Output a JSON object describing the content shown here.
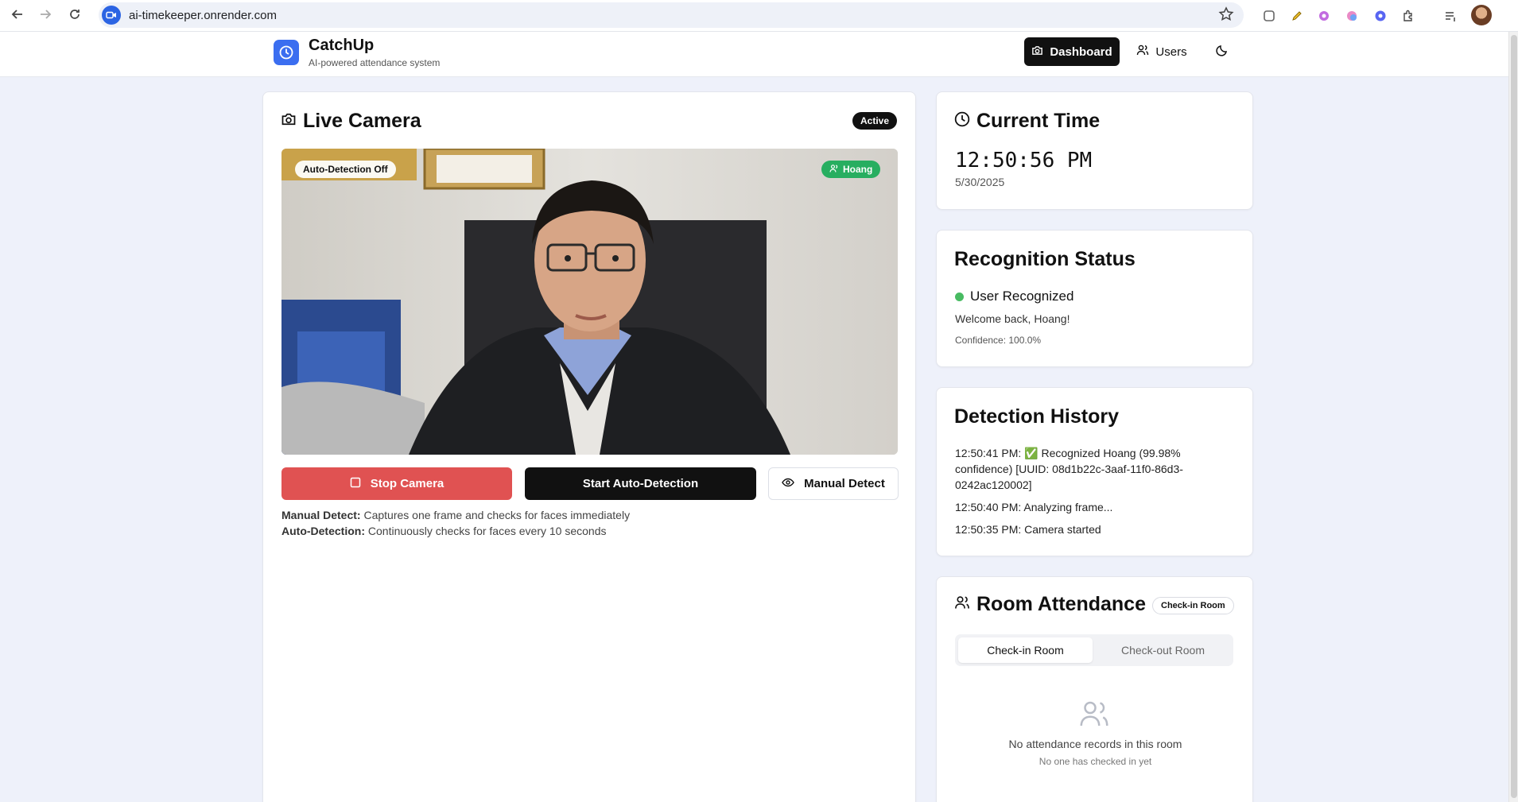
{
  "browser": {
    "url": "ai-timekeeper.onrender.com"
  },
  "header": {
    "app_name": "CatchUp",
    "tagline": "AI-powered attendance system",
    "nav": {
      "dashboard_label": "Dashboard",
      "users_label": "Users"
    }
  },
  "camera": {
    "title": "Live Camera",
    "status_badge": "Active",
    "auto_detection_overlay": "Auto-Detection Off",
    "recognized_overlay": "Hoang",
    "stop_label": "Stop Camera",
    "auto_label": "Start Auto-Detection",
    "manual_label": "Manual Detect",
    "help": {
      "manual_term": "Manual Detect:",
      "manual_desc": " Captures one frame and checks for faces immediately",
      "auto_term": "Auto-Detection:",
      "auto_desc": " Continuously checks for faces every 10 seconds"
    }
  },
  "current_time": {
    "title": "Current Time",
    "time": "12:50:56 PM",
    "date": "5/30/2025"
  },
  "recognition": {
    "title": "Recognition Status",
    "status": "User Recognized",
    "welcome": "Welcome back, Hoang!",
    "confidence": "Confidence: 100.0%"
  },
  "history": {
    "title": "Detection History",
    "items": [
      "12:50:41 PM: ✅ Recognized Hoang (99.98% confidence) [UUID: 08d1b22c-3aaf-11f0-86d3-0242ac120002]",
      "12:50:40 PM: Analyzing frame...",
      "12:50:35 PM: Camera started"
    ]
  },
  "room": {
    "title": "Room Attendance",
    "badge": "Check-in Room",
    "tabs": [
      "Check-in Room",
      "Check-out Room"
    ],
    "empty_title": "No attendance records in this room",
    "empty_sub": "No one has checked in yet"
  },
  "colors": {
    "accent": "#3b6ef0",
    "danger": "#e05252",
    "success": "#27ae60"
  }
}
